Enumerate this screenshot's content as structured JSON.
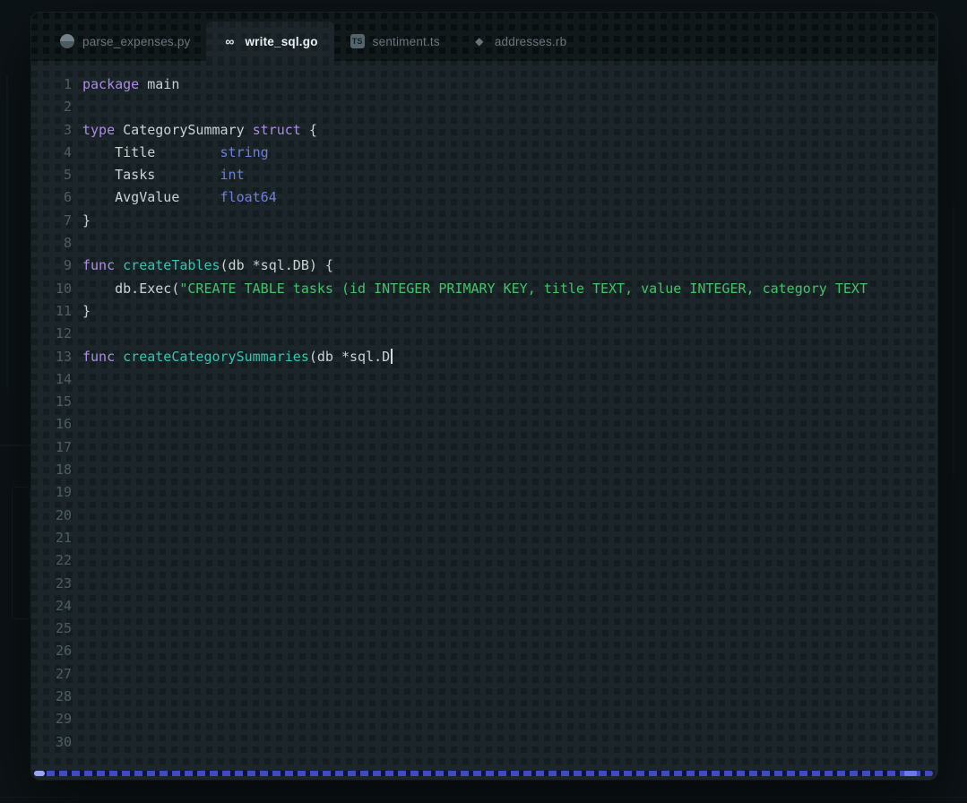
{
  "tabs": [
    {
      "label": "parse_expenses.py",
      "icon": "python-icon",
      "active": false
    },
    {
      "label": "write_sql.go",
      "icon": "go-icon",
      "active": true
    },
    {
      "label": "sentiment.ts",
      "icon": "typescript-icon",
      "active": false
    },
    {
      "label": "addresses.rb",
      "icon": "ruby-icon",
      "active": false
    }
  ],
  "editor": {
    "total_lines": 30,
    "cursor_line": 13,
    "lines": [
      {
        "n": 1,
        "tokens": [
          {
            "t": "keyword",
            "v": "package"
          },
          {
            "t": "plain",
            "v": " main"
          }
        ]
      },
      {
        "n": 2,
        "tokens": []
      },
      {
        "n": 3,
        "tokens": [
          {
            "t": "keyword",
            "v": "type"
          },
          {
            "t": "plain",
            "v": " CategorySummary "
          },
          {
            "t": "keyword",
            "v": "struct"
          },
          {
            "t": "plain",
            "v": " {"
          }
        ]
      },
      {
        "n": 4,
        "tokens": [
          {
            "t": "plain",
            "v": "    Title        "
          },
          {
            "t": "type",
            "v": "string"
          }
        ]
      },
      {
        "n": 5,
        "tokens": [
          {
            "t": "plain",
            "v": "    Tasks        "
          },
          {
            "t": "type",
            "v": "int"
          }
        ]
      },
      {
        "n": 6,
        "tokens": [
          {
            "t": "plain",
            "v": "    AvgValue     "
          },
          {
            "t": "type",
            "v": "float64"
          }
        ]
      },
      {
        "n": 7,
        "tokens": [
          {
            "t": "plain",
            "v": "}"
          }
        ]
      },
      {
        "n": 8,
        "tokens": []
      },
      {
        "n": 9,
        "tokens": [
          {
            "t": "keyword",
            "v": "func"
          },
          {
            "t": "function",
            "v": " createTables"
          },
          {
            "t": "plain",
            "v": "(db *sql.DB) {"
          }
        ]
      },
      {
        "n": 10,
        "tokens": [
          {
            "t": "plain",
            "v": "    db.Exec("
          },
          {
            "t": "string",
            "v": "\"CREATE TABLE tasks (id INTEGER PRIMARY KEY, title TEXT, value INTEGER, category TEXT"
          }
        ]
      },
      {
        "n": 11,
        "tokens": [
          {
            "t": "plain",
            "v": "}"
          }
        ]
      },
      {
        "n": 12,
        "tokens": []
      },
      {
        "n": 13,
        "tokens": [
          {
            "t": "keyword",
            "v": "func"
          },
          {
            "t": "function",
            "v": " createCategorySummaries"
          },
          {
            "t": "plain",
            "v": "(db *sql.D"
          }
        ],
        "cursor": true
      },
      {
        "n": 14,
        "tokens": []
      },
      {
        "n": 15,
        "tokens": []
      },
      {
        "n": 16,
        "tokens": []
      },
      {
        "n": 17,
        "tokens": []
      },
      {
        "n": 18,
        "tokens": []
      },
      {
        "n": 19,
        "tokens": []
      },
      {
        "n": 20,
        "tokens": []
      },
      {
        "n": 21,
        "tokens": []
      },
      {
        "n": 22,
        "tokens": []
      },
      {
        "n": 23,
        "tokens": []
      },
      {
        "n": 24,
        "tokens": []
      },
      {
        "n": 25,
        "tokens": []
      },
      {
        "n": 26,
        "tokens": []
      },
      {
        "n": 27,
        "tokens": []
      },
      {
        "n": 28,
        "tokens": []
      },
      {
        "n": 29,
        "tokens": []
      },
      {
        "n": 30,
        "tokens": []
      }
    ]
  },
  "colors": {
    "window_background": "#1c262a",
    "tabbar_background": "#141d21",
    "keyword": "#ab8ce4",
    "function": "#39c3ad",
    "type": "#6f7fd9",
    "string": "#46c06a",
    "plain_text": "#c9d2d5",
    "line_number": "#4e5d62",
    "scrollbar_accent": "#3f4cc0"
  }
}
